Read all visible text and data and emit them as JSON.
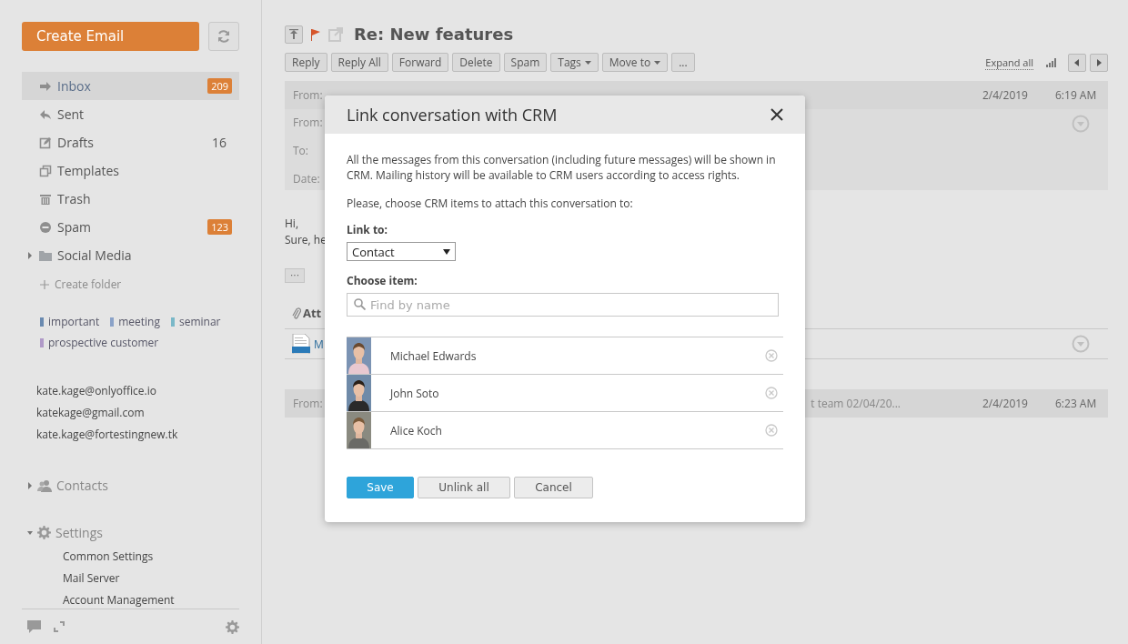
{
  "sidebar": {
    "create_button": "Create Email",
    "folders": [
      {
        "kind": "inbox",
        "label": "Inbox",
        "count": "209",
        "highlighted": true,
        "selected": true
      },
      {
        "kind": "sent",
        "label": "Sent",
        "selected": false
      },
      {
        "kind": "drafts",
        "label": "Drafts",
        "count": "16",
        "highlighted": false,
        "selected": false
      },
      {
        "kind": "templates",
        "label": "Templates",
        "selected": false
      },
      {
        "kind": "trash",
        "label": "Trash",
        "selected": false
      },
      {
        "kind": "spam",
        "label": "Spam",
        "count": "123",
        "highlighted": true,
        "selected": false
      },
      {
        "kind": "folder",
        "label": "Social Media",
        "expanded": false,
        "selected": false
      }
    ],
    "create_folder": "Create folder",
    "tags": [
      {
        "label": "important",
        "color": "#6a8ab0"
      },
      {
        "label": "meeting",
        "color": "#8aa2c8"
      },
      {
        "label": "seminar",
        "color": "#7ab8c8"
      },
      {
        "label": "prospective customer",
        "color": "#b09ac8"
      }
    ],
    "accounts": [
      "kate.kage@onlyoffice.io",
      "katekage@gmail.com",
      "kate.kage@fortestingnew.tk"
    ],
    "contacts": {
      "label": "Contacts",
      "expanded": false
    },
    "settings": {
      "label": "Settings",
      "expanded": true,
      "children": [
        "Common Settings",
        "Mail Server",
        "Account Management"
      ]
    }
  },
  "message": {
    "title": "Re: New features",
    "actions": [
      {
        "label": "Reply"
      },
      {
        "label": "Reply All"
      },
      {
        "label": "Forward"
      },
      {
        "label": "Delete"
      },
      {
        "label": "Spam"
      },
      {
        "label": "Tags",
        "dropdown": true
      },
      {
        "label": "Move to",
        "dropdown": true
      },
      {
        "label": "..."
      }
    ],
    "expand_all": "Expand all",
    "first_row": {
      "from_label": "From:",
      "date": "2/4/2019",
      "time": "6:19 AM"
    },
    "details": [
      "From:",
      "To:",
      "Date:"
    ],
    "body": [
      "Hi,",
      "Sure, he"
    ],
    "more_button": "···",
    "attachments_label": "Att",
    "attachment_name": "M",
    "last_row": {
      "from_label": "From:",
      "snippet": "t team 02/04/20...",
      "date": "2/4/2019",
      "time": "6:23 AM"
    }
  },
  "dialog": {
    "title": "Link conversation with CRM",
    "intro": "All the messages from this conversation (including future messages) will be shown in CRM. Mailing history will be available to CRM users according to access rights.",
    "prompt": "Please, choose CRM items to attach this conversation to:",
    "link_to_label": "Link to:",
    "link_to_value": "Contact",
    "choose_label": "Choose item:",
    "search": {
      "placeholder": "Find by name"
    },
    "items": [
      {
        "name": "Michael Edwards"
      },
      {
        "name": "John Soto"
      },
      {
        "name": "Alice Koch"
      }
    ],
    "buttons": [
      {
        "label": "Save",
        "kind": "primary"
      },
      {
        "label": "Unlink all",
        "kind": "secondary"
      },
      {
        "label": "Cancel",
        "kind": "secondary"
      }
    ]
  }
}
